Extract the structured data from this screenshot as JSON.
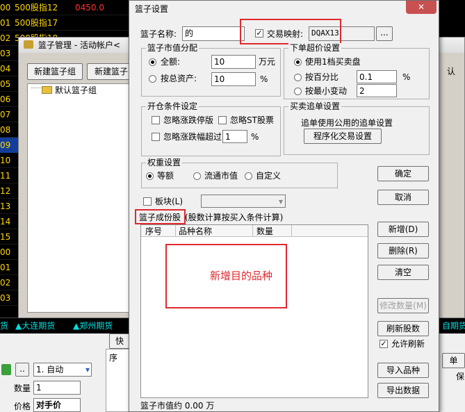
{
  "bg_rows": [
    {
      "num": "00",
      "text": "500股指12",
      "extra": "0450.0"
    },
    {
      "num": "01",
      "text": "500股指17",
      "extra": ""
    },
    {
      "num": "02",
      "text": "500股指18",
      "extra": ""
    },
    {
      "num": "03",
      "text": "",
      "extra": ""
    },
    {
      "num": "04",
      "text": "",
      "extra": ""
    },
    {
      "num": "05",
      "text": "",
      "extra": ""
    },
    {
      "num": "06",
      "text": "",
      "extra": ""
    },
    {
      "num": "07",
      "text": "",
      "extra": ""
    },
    {
      "num": "08",
      "text": "",
      "extra": ""
    },
    {
      "num": "09",
      "text": "",
      "extra": ""
    },
    {
      "num": "10",
      "text": "",
      "extra": ""
    },
    {
      "num": "11",
      "text": "",
      "extra": ""
    },
    {
      "num": "12",
      "text": "",
      "extra": ""
    },
    {
      "num": "13",
      "text": "",
      "extra": ""
    },
    {
      "num": "14",
      "text": "",
      "extra": ""
    },
    {
      "num": "15",
      "text": "",
      "extra": ""
    },
    {
      "num": "00",
      "text": "",
      "extra": ""
    },
    {
      "num": "01",
      "text": "",
      "extra": ""
    },
    {
      "num": "02",
      "text": "",
      "extra": ""
    },
    {
      "num": "03",
      "text": "",
      "extra": ""
    }
  ],
  "bottom_bar": {
    "left": "货",
    "item1": "▲大连期货",
    "item2": "▲郑州期货",
    "right": "自期货"
  },
  "lower_panel": {
    "combo": "1. 自动",
    "qty_label": "数量",
    "qty": "1",
    "price_label": "价格",
    "price": "对手价",
    "quick": "快",
    "header": "序",
    "right_btn": "单",
    "far_right": "保",
    "dots": ".."
  },
  "basket_mgr": {
    "title": "篮子管理 - 活动帐户<",
    "btn_new_group": "新建篮子组",
    "btn_new_basket": "新建篮子",
    "tree_item": "默认篮子组",
    "right_label": "认"
  },
  "dialog": {
    "title": "篮子设置",
    "name_label": "篮子名称:",
    "name_value": "的",
    "mapping_label": "交易映射:",
    "mapping_value": "DQAX13",
    "browse": "...",
    "mv_group": "篮子市值分配",
    "amount_label": "全额:",
    "amount_value": "10",
    "amount_unit": "万元",
    "total_label": "按总资产:",
    "total_value": "10",
    "total_unit": "%",
    "order_group": "下单超价设置",
    "opt1": "使用1档买卖盘",
    "opt2": "按百分比",
    "opt2_value": "0.1",
    "opt2_unit": "%",
    "opt3": "按最小变动",
    "opt3_value": "2",
    "open_group": "开仓条件设定",
    "cb1": "忽略涨跌停版",
    "cb2": "忽略ST股票",
    "cb3": "忽略涨跌幅超过",
    "cb3_value": "1",
    "cb3_unit": "%",
    "chase_group": "买卖追单设置",
    "chase_text": "追单使用公用的追单设置",
    "chase_btn": "程序化交易设置",
    "weight_group": "权重设置",
    "w1": "等额",
    "w2": "流通市值",
    "w3": "自定义",
    "ok": "确定",
    "cancel": "取消",
    "sector_label": "板块(L)",
    "components_label": "篮子成份股",
    "components_note": "(股数计算按买入条件计算)",
    "col1": "序号",
    "col2": "品种名称",
    "col3": "数量",
    "annotation": "新增目的品种",
    "add": "新增(D)",
    "del": "删除(R)",
    "clear": "清空",
    "modify": "修改数量(M)",
    "refresh": "刷新股数",
    "allow_refresh": "允许刷新",
    "import": "导入品种",
    "export": "导出数据",
    "footer": "篮子市值约 0.00 万"
  }
}
